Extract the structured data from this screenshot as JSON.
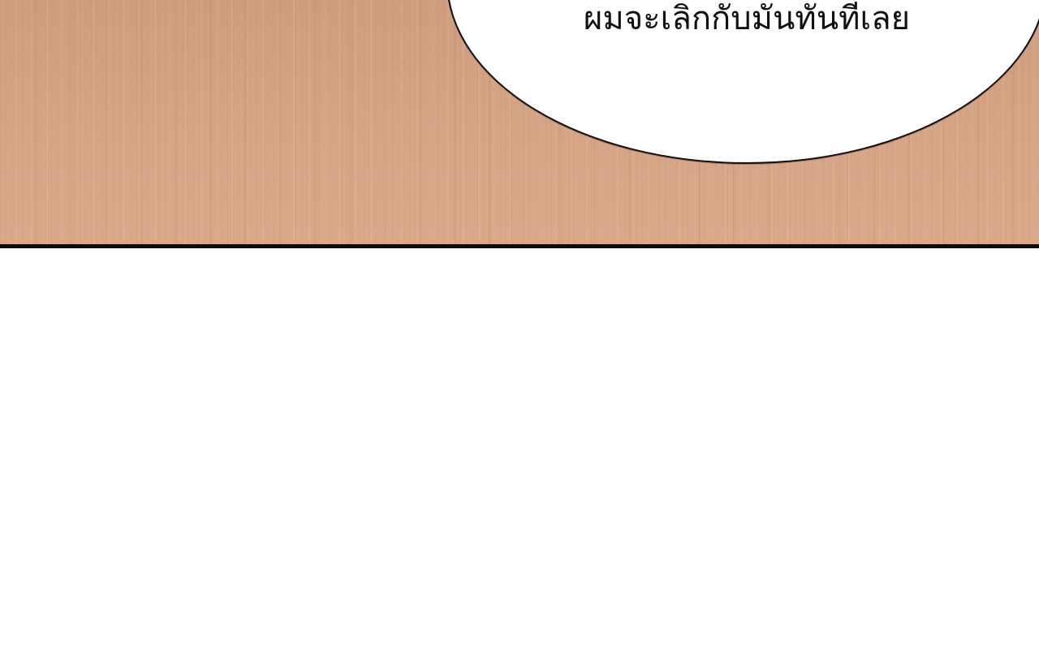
{
  "panel": {
    "speech_bubble": {
      "text": "ผมจะเลิกกับมันทันทีเลย"
    }
  },
  "colors": {
    "wood_background": "#d4a283",
    "bubble_fill": "#ffffff",
    "outline": "#111111",
    "page_background": "#ffffff"
  }
}
